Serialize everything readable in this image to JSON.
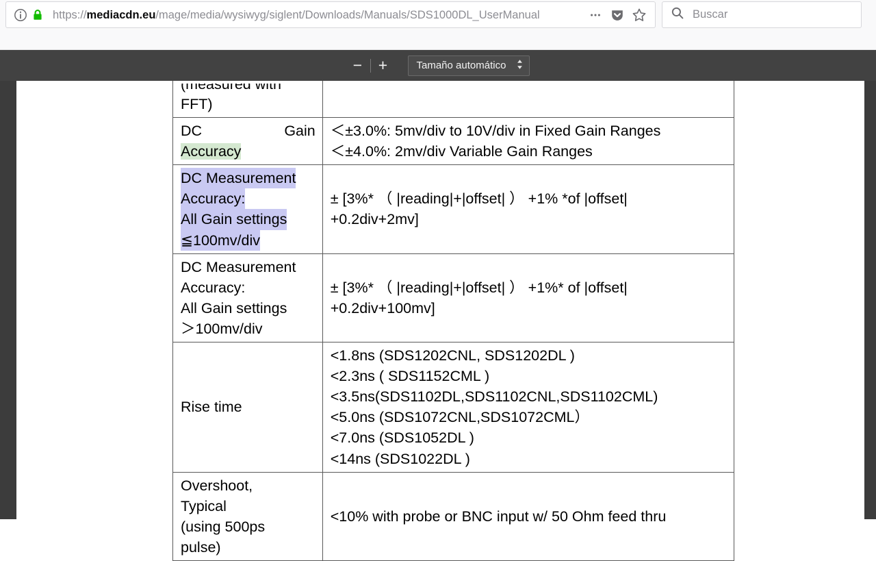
{
  "browser": {
    "url_prefix": "https://",
    "url_host": "mediacdn.eu",
    "url_path": "/mage/media/wysiwyg/siglent/Downloads/Manuals/SDS1000DL_UserManual",
    "info_icon": "info-circle-icon",
    "lock_icon": "padlock-icon",
    "page_actions_icon": "ellipsis-icon",
    "pocket_icon": "pocket-shield-icon",
    "bookmark_icon": "star-outline-icon",
    "search": {
      "placeholder": "Buscar",
      "value": "",
      "icon": "search-icon"
    }
  },
  "pdf_toolbar": {
    "zoom_out_label": "−",
    "zoom_in_label": "+",
    "scale_value": "Tamaño automático",
    "scale_options": [
      "Tamaño automático"
    ],
    "scale_arrows_icon": "updown-arrows-icon"
  },
  "document": {
    "table_rows": [
      {
        "label_cut_line": "(measured with",
        "label_lines": [
          "FFT)"
        ],
        "value_lines": []
      },
      {
        "label_justified_line": "DC                 Gain",
        "label_highlight_green": "Accuracy",
        "value_lines": [
          "＜±3.0%: 5mv/div to 10V/div in Fixed Gain Ranges",
          "＜±4.0%: 2mv/div Variable Gain Ranges"
        ]
      },
      {
        "selected_lines": [
          "DC Measurement",
          "Accuracy:",
          "All  Gain  settings",
          "≦100mv/div"
        ],
        "value_lines": [
          "±  [3%*  （ |reading|+|offset| ）  +1%   *of   |offset|",
          "+0.2div+2mv]"
        ]
      },
      {
        "label_lines": [
          "DC Measurement",
          "Accuracy:",
          "All  Gain  settings",
          "＞100mv/div"
        ],
        "value_lines": [
          "±  [3%*  （ |reading|+|offset| ）  +1%*   of   |offset|",
          "+0.2div+100mv]"
        ]
      },
      {
        "label_lines": [
          "Rise time"
        ],
        "value_lines": [
          "<1.8ns (SDS1202CNL, SDS1202DL )",
          "<2.3ns ( SDS1152CML )",
          "<3.5ns(SDS1102DL,SDS1102CNL,SDS1102CML)",
          "<5.0ns (SDS1072CNL,SDS1072CML）",
          "<7.0ns (SDS1052DL )",
          "<14ns (SDS1022DL )"
        ]
      },
      {
        "label_lines": [
          "Overshoot,",
          "Typical",
          "(using 500ps",
          "pulse)"
        ],
        "value_lines": [
          "<10% with probe or BNC input w/ 50 Ohm feed thru"
        ]
      }
    ]
  },
  "colors": {
    "chrome_bg": "#f9f9fa",
    "pdf_toolbar_bg": "#424242",
    "viewer_bg": "#3c3c3c",
    "page_bg": "#ffffff",
    "lock_green": "#12bc00",
    "highlight_green": "#d4e8d0",
    "selection_purple": "#c9c9f2"
  }
}
